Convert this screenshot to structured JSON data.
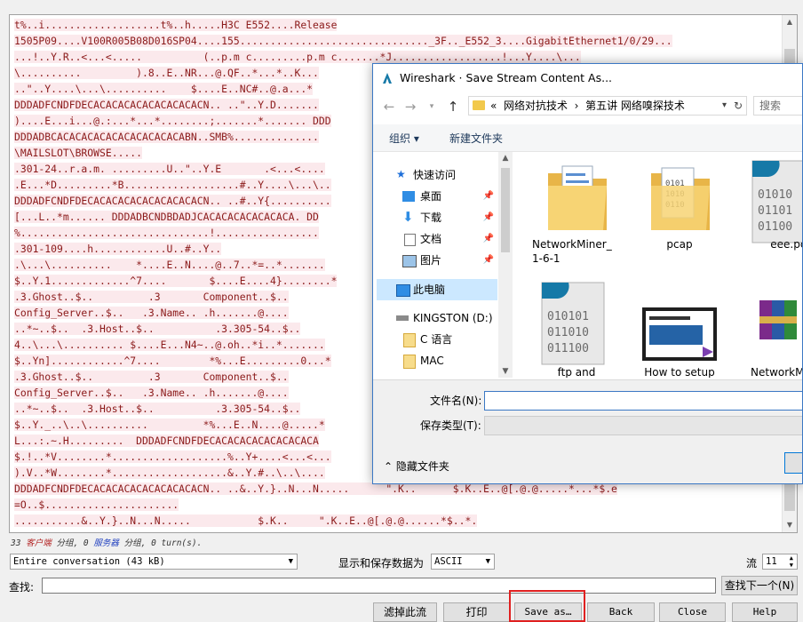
{
  "stream": {
    "lines": [
      "t%..i...................t%..h.....H3C E552....Release",
      "1505P09....V100R005B08D016SP04....155..............................._3F.._E552_3....GigabitEthernet1/0/29...",
      "...!..Y.R..<...<.....          (..p.m c.........p.m c.......*J..................!...Y....\\...",
      "\\..........         ).8..E..NR...@.QF..*...*..K...",
      "..\"..Y....\\...\\..........    $....E..NC#..@.a...*",
      "DDDADFCNDFDECACACACACACACACACACN.. ..\"..Y.D.......",
      ")....E...i...@.:...*...*........;.......*....... DDD",
      "DDDADBCACACACACACACACACACACABN..SMB%..............",
      "\\MAILSLOT\\BROWSE.....",
      ".301-24..r.a.m. .........U..\"..Y.E       .<...<....",
      ".E...*D.........*B...................#..Y....\\...\\..",
      "DDDADFCNDFDECACACACACACACACACACN.. ..#..Y{..........",
      "[...L..*m...... DDDADBCNDBDADJCACACACACACACACA. DD",
      "%...............................!.................",
      ".301-109....h............U..#..Y..",
      ".\\...\\..........    *....E..N....@..7..*=..*.......",
      "$..Y.1.............^7....       $....E....4}........*",
      ".3.Ghost..$..         .3       Component..$..",
      "Config_Server..$..   .3.Name.. .h.......@....",
      "..*~..$..  .3.Host..$..          .3.305-54..$..",
      "4..\\...\\.......... $....E...N4~..@.oh..*i..*.......",
      "$..Yn]............^7....        *%...E.........0...*",
      ".3.Ghost..$..         .3       Component..$..",
      "Config_Server..$..   .3.Name.. .h.......@....",
      "..*~..$..  .3.Host..$..          .3.305-54..$..",
      "$..Y._..\\..\\..........         *%...E..N....@.....*",
      "L...:.~.H.........  DDDADFCNDFDECACACACACACACACACA",
      "$.!..*V........*...................%..Y+....<...<...",
      ").V..*W........*...................&..Y.#..\\..\\....",
      "DDDADFCNDFDECACACACACACACACACACN.. ..&..Y.}..N...N.....      \".K..      $.K..E..@[.@.@.....*...*$.e",
      "=O..$......................",
      "...........&..Y.}..N...N.....           $.K..     \".K..E..@[.@.@......*$..*."
    ]
  },
  "summary": {
    "count": "33",
    "client": "客户端",
    "pkts1": "分组,",
    "zero1": "0",
    "server": "服务器",
    "pkts2": "分组,",
    "turns": "0 turn(s)."
  },
  "controls": {
    "conversation": "Entire conversation (43 kB)",
    "show_save_label": "显示和保存数据为",
    "format": "ASCII",
    "stream_label": "流",
    "stream_value": "11",
    "find_label": "查找:",
    "find_next": "查找下一个(N)",
    "buttons": {
      "filter_out": "滤掉此流",
      "print": "打印",
      "save_as": "Save as…",
      "back": "Back",
      "close": "Close",
      "help": "Help"
    }
  },
  "dialog": {
    "title": "Wireshark · Save Stream Content As...",
    "breadcrumb": {
      "prefix": "«",
      "parts": [
        "网络对抗技术",
        "第五讲 网络嗅探技术"
      ],
      "sep": "›"
    },
    "search_placeholder": "搜索",
    "organize": "组织 ▾",
    "new_folder": "新建文件夹",
    "nav": {
      "quick_access": "快速访问",
      "desktop": "桌面",
      "downloads": "下载",
      "documents": "文档",
      "pictures": "图片",
      "this_pc": "此电脑",
      "drive": "KINGSTON (D:)",
      "c_lang": "C 语言",
      "mac": "MAC"
    },
    "files": [
      {
        "name": "NetworkMiner_\n1-6-1"
      },
      {
        "name": "pcap"
      },
      {
        "name": "eee.pca"
      },
      {
        "name": "ftp and"
      },
      {
        "name": "How to setup"
      },
      {
        "name": "NetworkMi"
      }
    ],
    "filename_label": "文件名(N):",
    "filetype_label": "保存类型(T):",
    "hide_folders": "隐藏文件夹",
    "colors": {
      "accent": "#0078d7",
      "folder": "#f2c94c"
    }
  }
}
